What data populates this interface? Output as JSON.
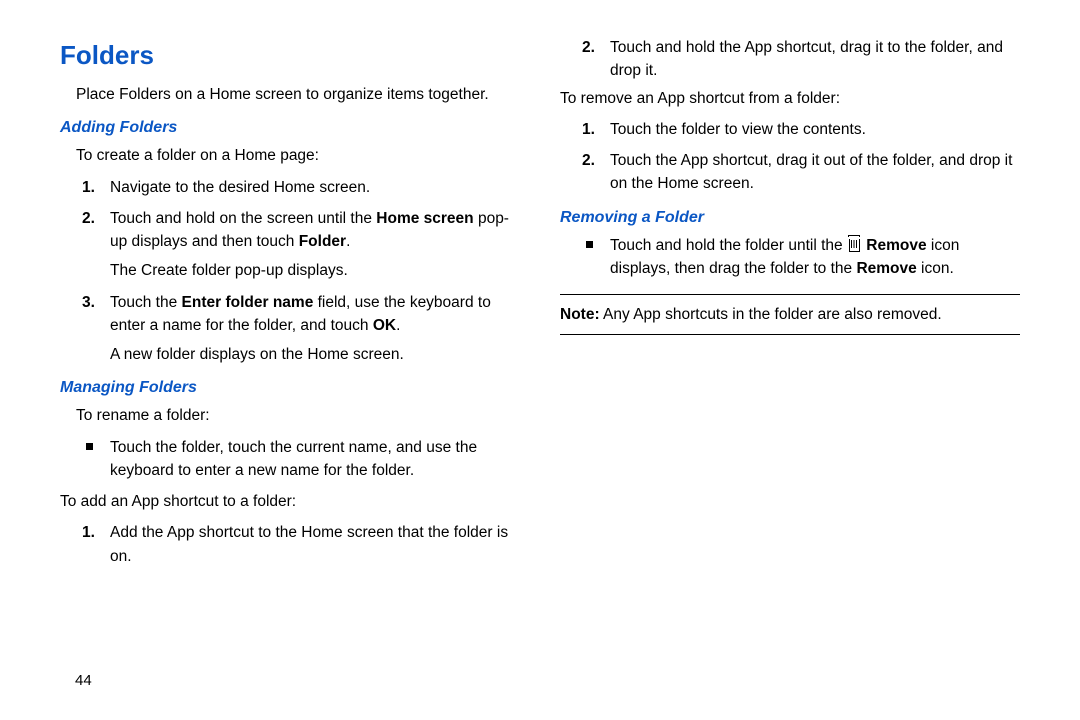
{
  "h1": "Folders",
  "intro": "Place Folders on a Home screen to organize items together.",
  "adding": {
    "title": "Adding Folders",
    "lead": "To create a folder on a Home page:",
    "s1": "Navigate to the desired Home screen.",
    "s2a": "Touch and hold on the screen until the ",
    "s2b": "Home screen",
    "s2c": " pop-up displays and then touch ",
    "s2d": "Folder",
    "s2e": ".",
    "s2sub": "The Create folder pop-up displays.",
    "s3a": "Touch the ",
    "s3b": "Enter folder name",
    "s3c": " field, use the keyboard to enter a name for the folder, and touch ",
    "s3d": "OK",
    "s3e": ".",
    "s3sub": "A new folder displays on the Home screen."
  },
  "managing": {
    "title": "Managing Folders",
    "rename_lead": "To rename a folder:",
    "rename_item": "Touch the folder, touch the current name, and use the keyboard to enter a new name for the folder.",
    "add_lead": "To add an App shortcut to a folder:",
    "add1": "Add the App shortcut to the Home screen that the folder is on.",
    "add2": "Touch and hold the App shortcut, drag it to the folder, and drop it.",
    "remove_lead": "To remove an App shortcut from a folder:",
    "rem1": "Touch the folder to view the contents.",
    "rem2": "Touch the App shortcut, drag it out of the folder, and drop it on the Home screen."
  },
  "removing": {
    "title": "Removing a Folder",
    "item_a": "Touch and hold the folder until the ",
    "item_b": "Remove",
    "item_c": " icon displays, then drag the folder to the ",
    "item_d": "Remove",
    "item_e": " icon."
  },
  "note_label": "Note:",
  "note_text": " Any App shortcuts in the folder are also removed.",
  "page_number": "44"
}
